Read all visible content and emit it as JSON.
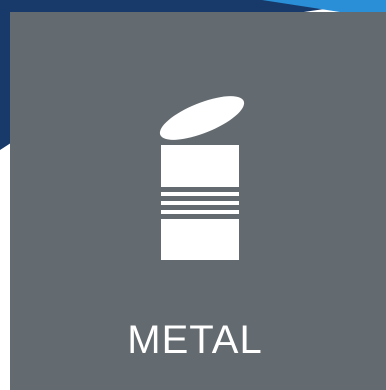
{
  "sign": {
    "label": "METAL",
    "icon": "tin-can-icon",
    "panel_color": "#646b70",
    "accent_dark_blue": "#173a6b",
    "accent_light_blue": "#2a8fd6"
  }
}
